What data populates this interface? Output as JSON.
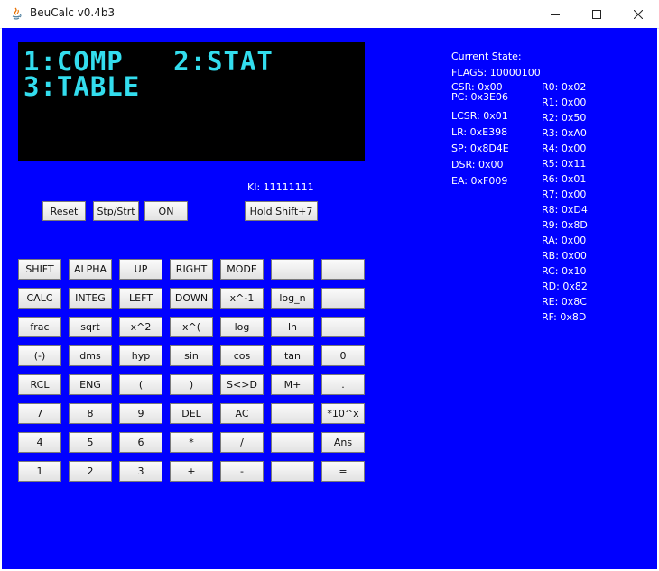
{
  "window": {
    "title": "BeuCalc v0.4b3"
  },
  "lcd": {
    "line1": "1:COMP   2:STAT",
    "line2": "3:TABLE"
  },
  "ki_label": "KI: 11111111",
  "controls": {
    "reset": "Reset",
    "stop_start": "Stp/Strt",
    "on": "ON",
    "hold_shift": "Hold Shift+7"
  },
  "keypad": {
    "rows": [
      [
        "SHIFT",
        "ALPHA",
        "UP",
        "RIGHT",
        "MODE",
        "",
        ""
      ],
      [
        "CALC",
        "INTEG",
        "LEFT",
        "DOWN",
        "x^-1",
        "log_n",
        ""
      ],
      [
        "frac",
        "sqrt",
        "x^2",
        "x^(",
        "log",
        "ln",
        ""
      ],
      [
        "(-)",
        "dms",
        "hyp",
        "sin",
        "cos",
        "tan",
        "0"
      ],
      [
        "RCL",
        "ENG",
        "(",
        ")",
        "S<>D",
        "M+",
        "."
      ],
      [
        "7",
        "8",
        "9",
        "DEL",
        "AC",
        "",
        "*10^x"
      ],
      [
        "4",
        "5",
        "6",
        "*",
        "/",
        "",
        "Ans"
      ],
      [
        "1",
        "2",
        "3",
        "+",
        "-",
        "",
        "="
      ]
    ]
  },
  "state": {
    "header": "Current State:",
    "flags": "FLAGS: 10000100",
    "left": [
      "CSR: 0x00",
      "PC: 0x3E06",
      "LCSR: 0x01",
      "LR: 0xE398",
      "SP: 0x8D4E",
      "DSR: 0x00",
      "EA: 0xF009"
    ],
    "registers": [
      "R0: 0x02",
      "R1: 0x00",
      "R2: 0x50",
      "R3: 0xA0",
      "R4: 0x00",
      "R5: 0x11",
      "R6: 0x01",
      "R7: 0x00",
      "R8: 0xD4",
      "R9: 0x8D",
      "RA: 0x00",
      "RB: 0x00",
      "RC: 0x10",
      "RD: 0x82",
      "RE: 0x8C",
      "RF: 0x8D"
    ]
  },
  "colors": {
    "background": "#0000ff",
    "lcd_background": "#000000",
    "lcd_text": "#33ddee"
  }
}
